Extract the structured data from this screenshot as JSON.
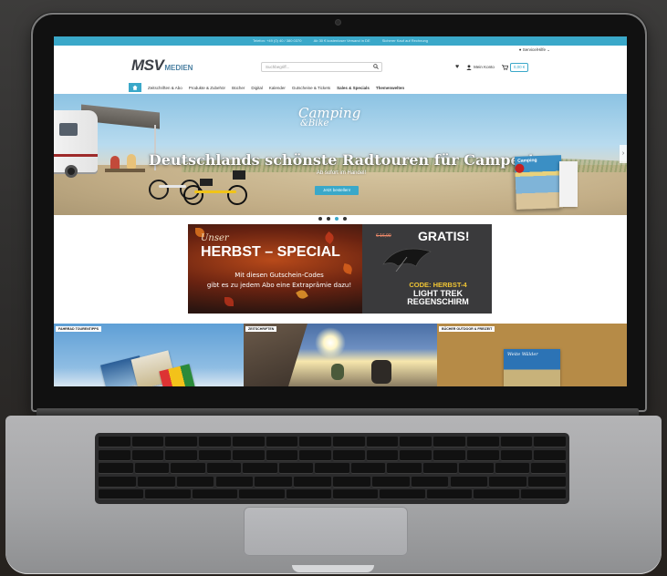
{
  "site": {
    "topbar": [
      "Telefon: +49 (0) 40 / 380 0370",
      "Ab 30 € kostenloser Versand in DE",
      "Sicherer Kauf auf Rechnung"
    ],
    "service": "Service/Hilfe",
    "logo": {
      "main": "MSV",
      "sub": "MEDIEN"
    },
    "search_placeholder": "Suchbegriff...",
    "account_label": "Mein Konto",
    "cart_label": "0,00 €",
    "nav": [
      "Zeitschriften & Abo",
      "Produkte & Zubehör",
      "Bücher",
      "Digital",
      "Kalender",
      "Gutscheine & Tickets",
      "Sales & Specials",
      "Themenwelten"
    ],
    "accent": "#3aa8c9"
  },
  "hero": {
    "logo_line1": "Camping",
    "logo_line2": "&Bike",
    "title": "Deutschlands schönste Radtouren für Camper!",
    "subtitle": "Ab sofort im Handel!",
    "button": "Jetzt bestellen!",
    "magazine_title": "Camping"
  },
  "banner": {
    "unser": "Unser",
    "special": "HERBST – SPECIAL",
    "text_line1": "Mit diesen Gutschein-Codes",
    "text_line2": "gibt es zu jedem Abo eine Extraprämie dazu!",
    "old_price": "€ 16,90",
    "gratis": "GRATIS!",
    "code": "CODE: HERBST-4",
    "product_line1": "LIGHT TREK",
    "product_line2": "REGENSCHIRM"
  },
  "tiles": [
    {
      "label": "FAHRRAD TOURENTIPPS"
    },
    {
      "label": "ZEITSCHRIFTEN"
    },
    {
      "label": "BÜCHER OUTDOOR & FREIZEIT",
      "book_title": "Weite Wälder"
    }
  ]
}
